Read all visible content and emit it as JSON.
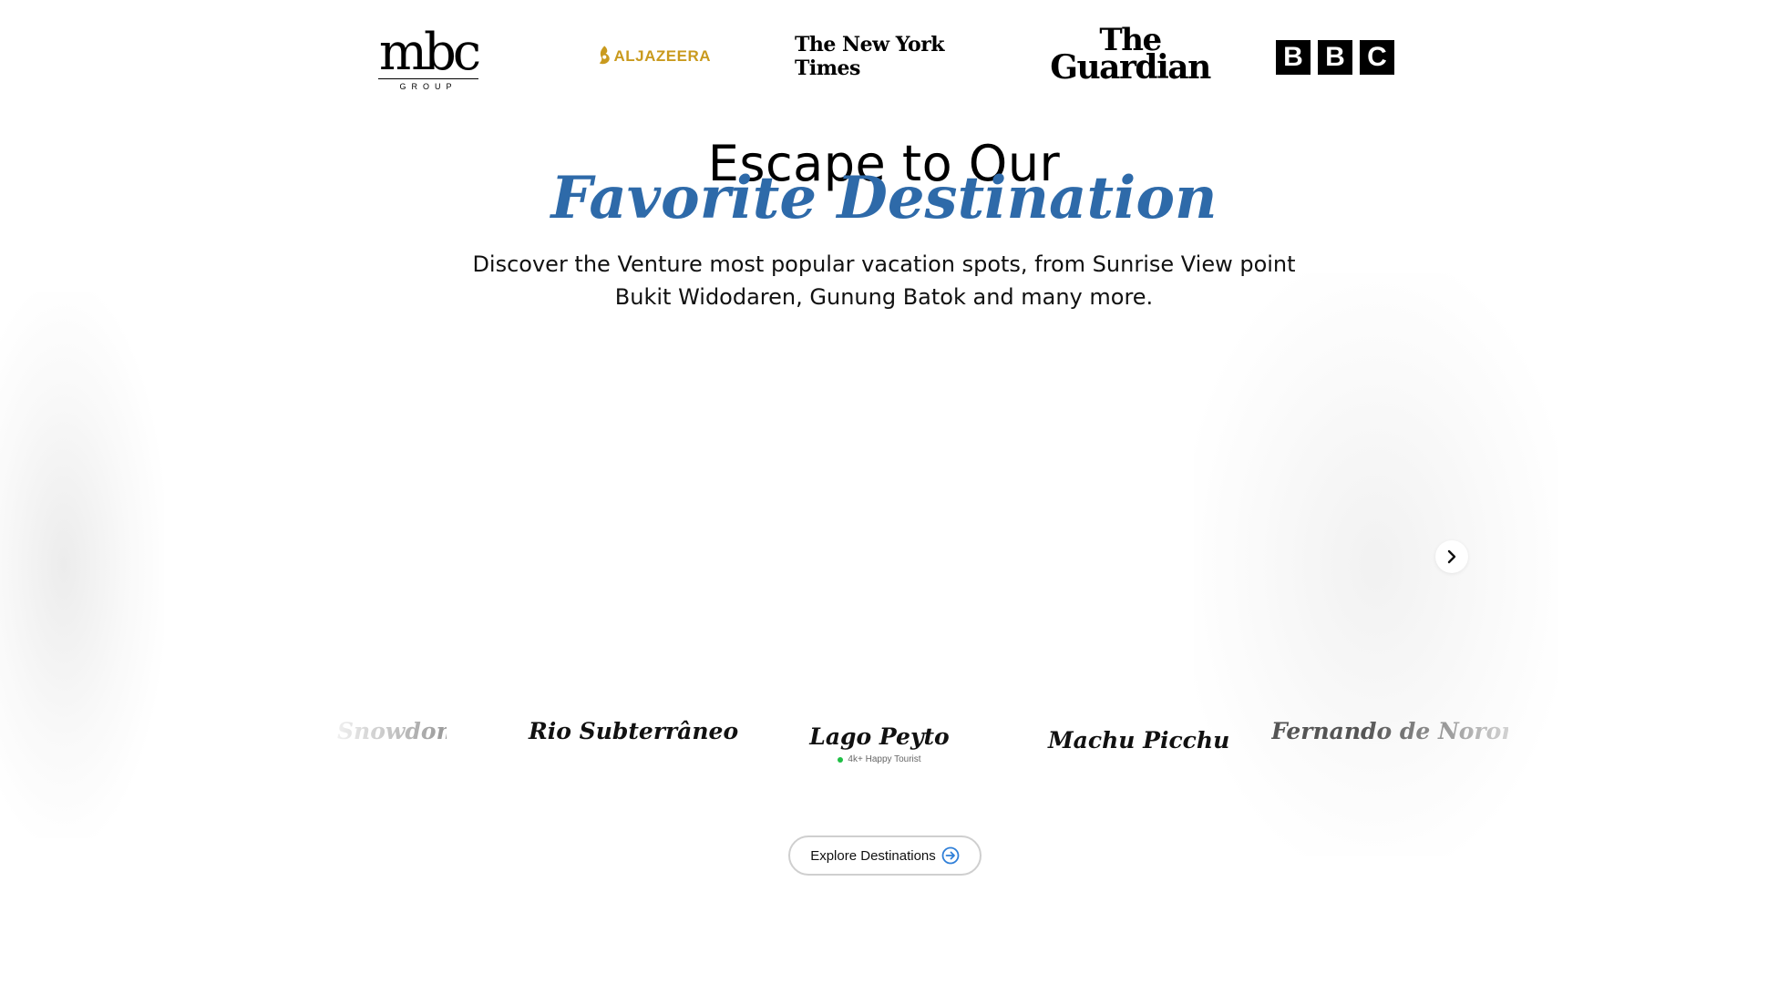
{
  "logos": {
    "mbc": {
      "word": "mbc",
      "sub": "GROUP"
    },
    "aljazeera": {
      "text": "ALJAZEERA",
      "color": "#c99a1e"
    },
    "nyt": {
      "text": "The New York Times"
    },
    "guardian": {
      "the": "The",
      "name": "Guardian"
    },
    "bbc": {
      "letters": [
        "B",
        "B",
        "C"
      ]
    }
  },
  "hero": {
    "title_line1": "Escape to Our",
    "title_line2": "Favorite Destination",
    "accent_color": "#2e6aa9",
    "subtitle_line1": "Discover the Venture most popular vacation spots, from Sunrise View point",
    "subtitle_line2": "Bukit Widodaren, Gunung Batok and many more."
  },
  "destinations": [
    {
      "name": "Snowdon"
    },
    {
      "name": "Rio Subterrâneo"
    },
    {
      "name": "Lago Peyto",
      "badge": "4k+ Happy Tourist"
    },
    {
      "name": "Machu Picchu"
    },
    {
      "name": "Fernando de Noronha"
    }
  ],
  "carousel": {
    "next_icon": "chevron-right-icon"
  },
  "cta": {
    "label": "Explore Destinations",
    "icon": "arrow-right-circle-icon"
  }
}
